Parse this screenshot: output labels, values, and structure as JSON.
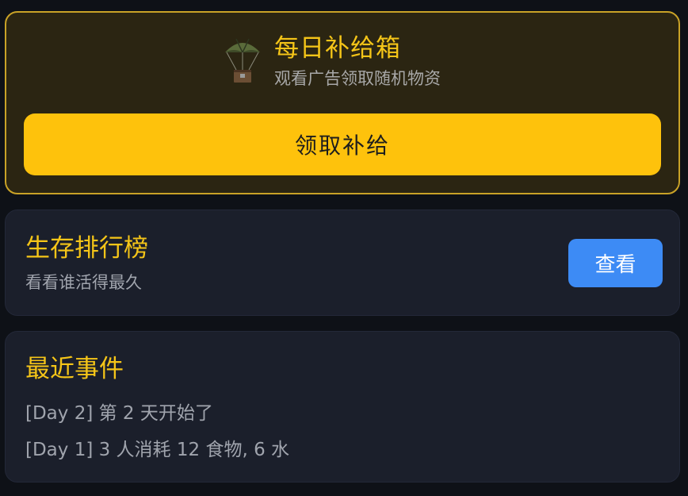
{
  "supply": {
    "icon": "parachute-crate-icon",
    "title": "每日补给箱",
    "subtitle": "观看广告领取随机物资",
    "claim_label": "领取补给"
  },
  "leaderboard": {
    "title": "生存排行榜",
    "subtitle": "看看谁活得最久",
    "view_label": "查看"
  },
  "events": {
    "title": "最近事件",
    "items": [
      "[Day 2] 第 2 天开始了",
      "[Day 1] 3 人消耗 12 食物, 6 水"
    ]
  },
  "colors": {
    "background": "#0e1117",
    "card": "#1b1f2b",
    "accent_gold": "#f5c518",
    "claim_button": "#fec20c",
    "view_button": "#3d8bf5"
  }
}
